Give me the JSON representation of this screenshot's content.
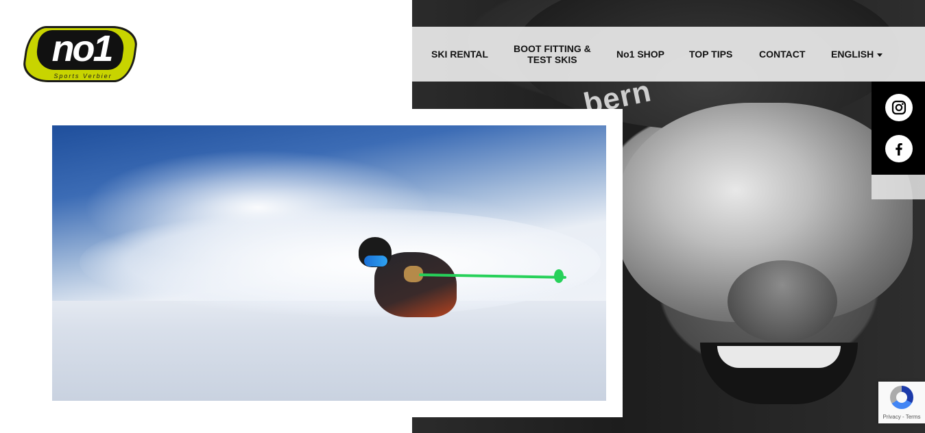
{
  "logo": {
    "mark": "no1",
    "tagline": "Sports Verbier",
    "colors": {
      "primary": "#c8d400",
      "dark": "#111111"
    }
  },
  "nav": {
    "items": [
      {
        "label": "SKI RENTAL"
      },
      {
        "label": "BOOT FITTING &",
        "label2": "TEST SKIS"
      },
      {
        "label": "No1 SHOP"
      },
      {
        "label": "TOP TIPS"
      },
      {
        "label": "CONTACT"
      },
      {
        "label": "ENGLISH"
      }
    ],
    "background": "#e8e8e8"
  },
  "social": {
    "icons": [
      "instagram-icon",
      "facebook-icon"
    ]
  },
  "hero": {
    "helmet_brand": "bern"
  },
  "recaptcha": {
    "privacy": "Privacy",
    "separator": " - ",
    "terms": "Terms"
  }
}
